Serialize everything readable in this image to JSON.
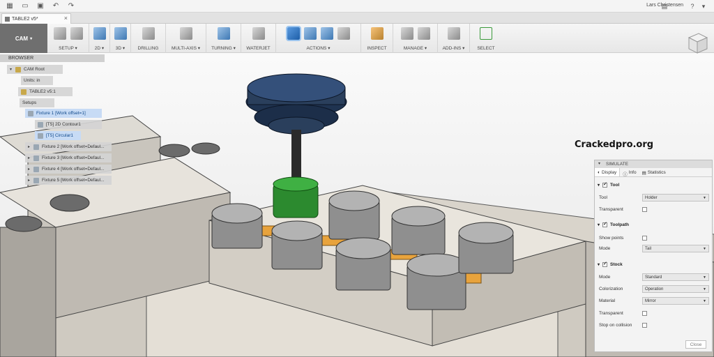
{
  "app": {
    "user": "Lars Christensen",
    "doc_tab": "TABLE2 v5*"
  },
  "ribbon": {
    "workspace": "CAM",
    "groups": [
      "SETUP",
      "2D",
      "3D",
      "DRILLING",
      "MULTI-AXIS",
      "TURNING",
      "WATERJET",
      "ACTIONS",
      "INSPECT",
      "MANAGE",
      "ADD-INS",
      "SELECT"
    ]
  },
  "browser": {
    "title": "BROWSER",
    "items": [
      {
        "label": "CAM Root"
      },
      {
        "label": "Units: in"
      },
      {
        "label": "TABLE2 v5:1"
      },
      {
        "label": "Setups"
      },
      {
        "label": "Fixture 1 [Work offset=1]"
      },
      {
        "label": "[T5] 2D Contour1"
      },
      {
        "label": "[T5] Circular1"
      },
      {
        "label": "Fixture 2 [Work offset=Defaul..."
      },
      {
        "label": "Fixture 3 [Work offset=Defaul..."
      },
      {
        "label": "Fixture 4 [Work offset=Defaul..."
      },
      {
        "label": "Fixture 5 [Work offset=Defaul..."
      }
    ]
  },
  "watermark": "Crackedpro.org",
  "simulate": {
    "title": "SIMULATE",
    "tabs": [
      "Display",
      "Info",
      "Statistics"
    ],
    "tool_section": "Tool",
    "tool_label": "Tool",
    "tool_value": "Holder",
    "tool_transparent": "Transparent",
    "toolpath_section": "Toolpath",
    "show_points": "Show points",
    "mode_label": "Mode",
    "toolpath_mode": "Tail",
    "stock_section": "Stock",
    "stock_mode_label": "Mode",
    "stock_mode": "Standard",
    "colorization_label": "Colorization",
    "colorization": "Operation",
    "material_label": "Material",
    "material": "Mirror",
    "stock_transparent": "Transparent",
    "stop_on_collision": "Stop on collision",
    "close": "Close"
  },
  "colors": {
    "ribbon_cam_bg": "#6f6f6f",
    "selection": "#c7dbf5",
    "spindle": "#2a3f5c",
    "tool_green": "#2c8a2f",
    "clamp_orange": "#e8a33c"
  }
}
